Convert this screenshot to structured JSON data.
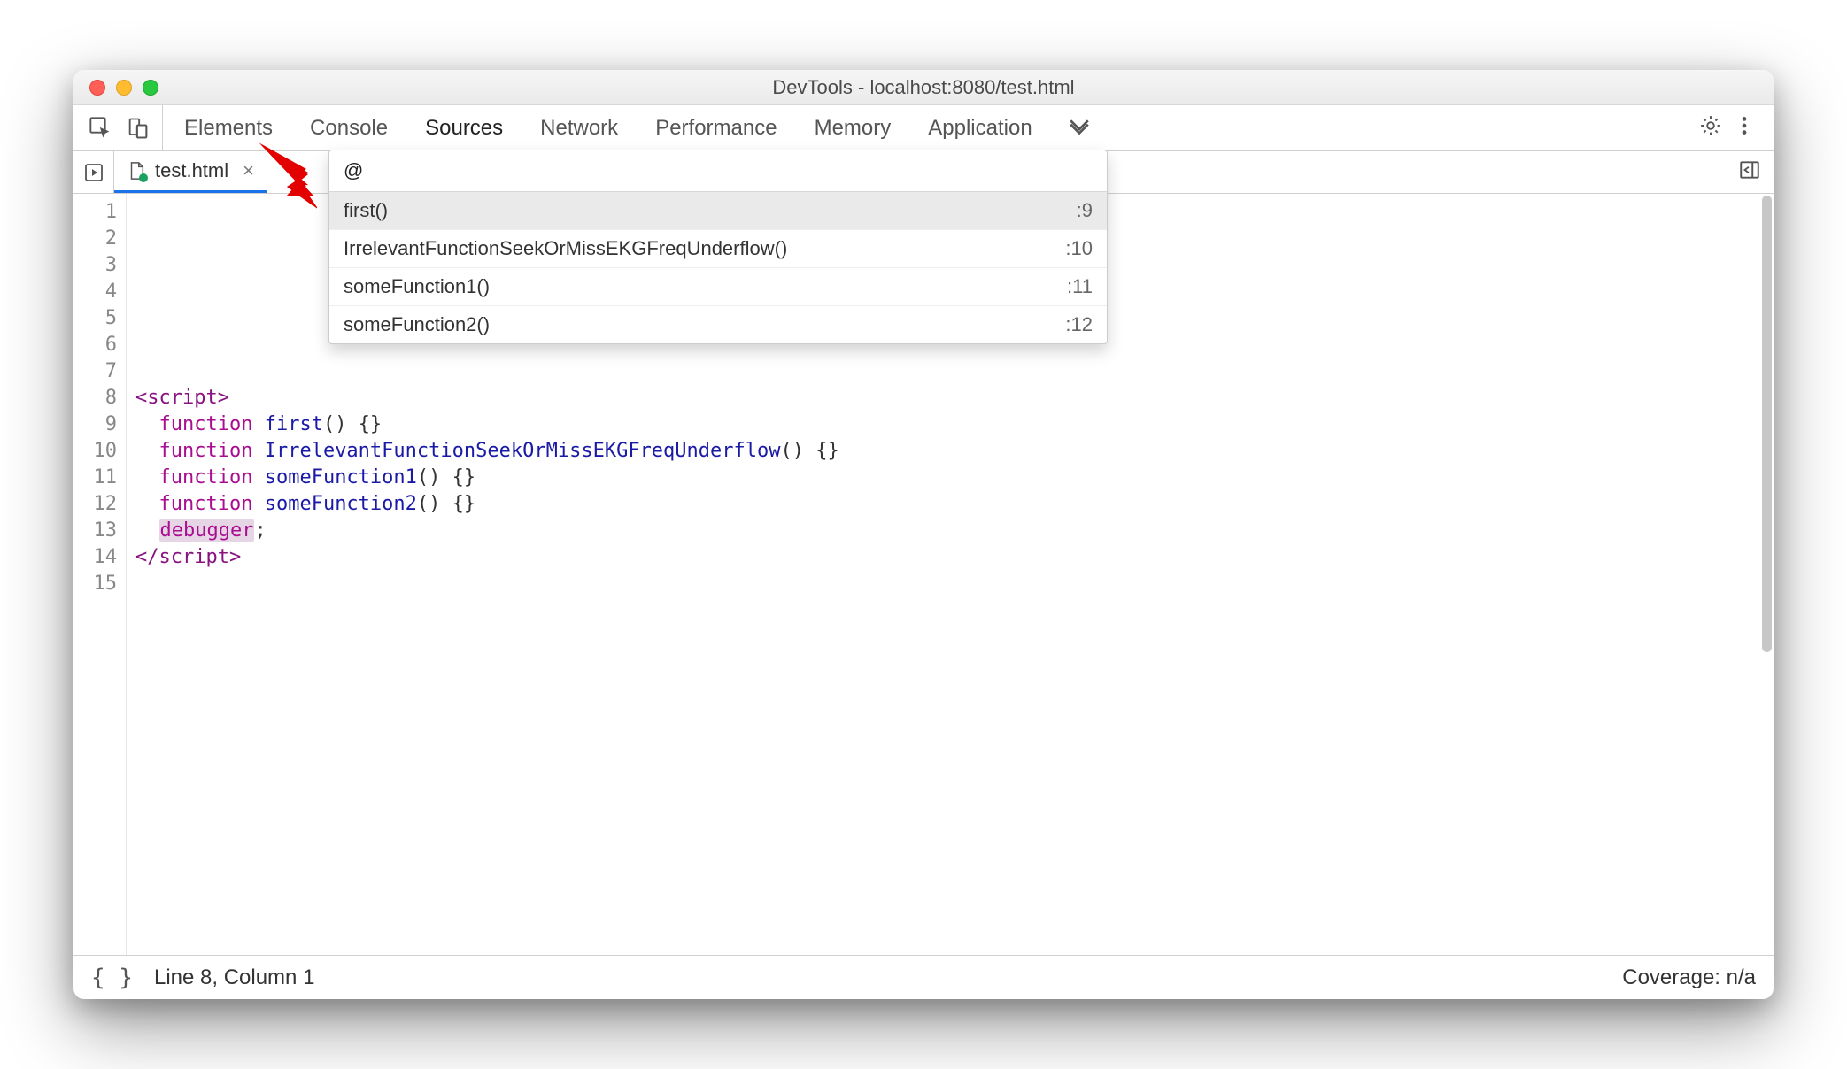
{
  "window": {
    "title": "DevTools - localhost:8080/test.html"
  },
  "tabs": {
    "items": [
      "Elements",
      "Console",
      "Sources",
      "Network",
      "Performance",
      "Memory",
      "Application"
    ],
    "active_index": 2
  },
  "file_tab": {
    "label": "test.html"
  },
  "palette": {
    "query": "@",
    "items": [
      {
        "label": "first()",
        "line": ":9"
      },
      {
        "label": "IrrelevantFunctionSeekOrMissEKGFreqUnderflow()",
        "line": ":10"
      },
      {
        "label": "someFunction1()",
        "line": ":11"
      },
      {
        "label": "someFunction2()",
        "line": ":12"
      }
    ],
    "active_index": 0
  },
  "gutter_lines": [
    "1",
    "2",
    "3",
    "4",
    "5",
    "6",
    "7",
    "8",
    "9",
    "10",
    "11",
    "12",
    "13",
    "14",
    "15"
  ],
  "code": {
    "fn1": "first",
    "fn2": "IrrelevantFunctionSeekOrMissEKGFreqUnderflow",
    "fn3": "someFunction1",
    "fn4": "someFunction2"
  },
  "status": {
    "cursor": "Line 8, Column 1",
    "coverage": "Coverage: n/a"
  }
}
